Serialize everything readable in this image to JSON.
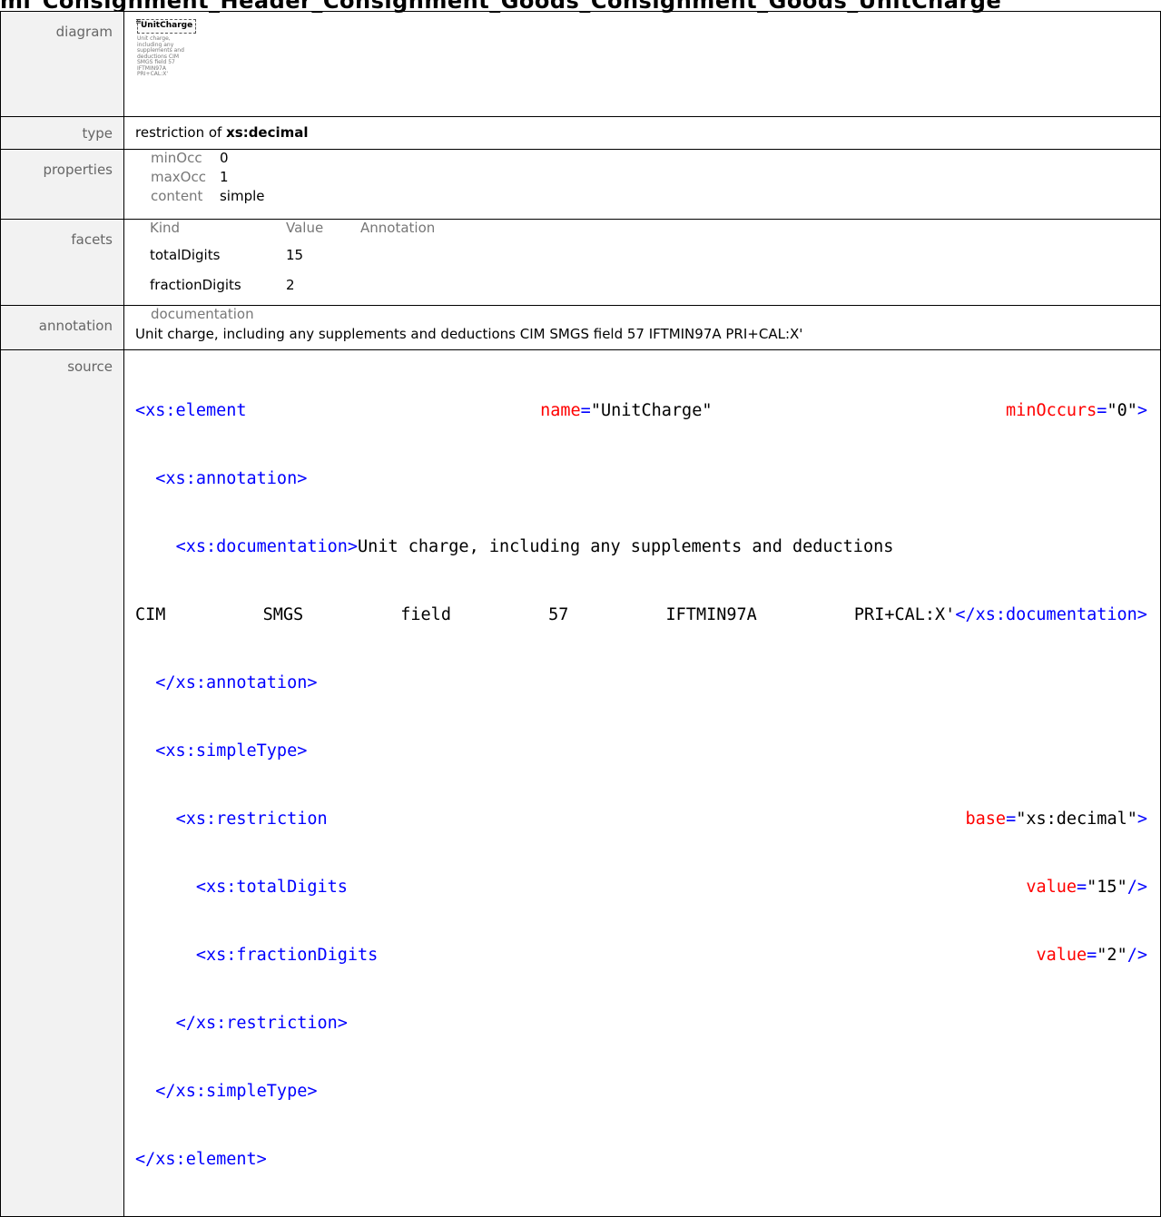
{
  "header": {
    "cut_title": "ml_Consignment_Header_Consignment_Goods_Consignment_Goods_UnitCharge"
  },
  "labels": {
    "diagram": "diagram",
    "type": "type",
    "properties": "properties",
    "facets": "facets",
    "annotation": "annotation",
    "source": "source"
  },
  "diagram": {
    "element_name": "UnitCharge",
    "documentation_lines": [
      "Unit charge,",
      "including any",
      "supplements and",
      "deductions CIM",
      "SMGS field 57",
      "IFTMIN97A",
      "PRI+CAL:X'"
    ]
  },
  "type": {
    "prefix": "restriction of",
    "base": "xs:decimal"
  },
  "properties": [
    {
      "key": "minOcc",
      "value": "0"
    },
    {
      "key": "maxOcc",
      "value": "1"
    },
    {
      "key": "content",
      "value": "simple"
    }
  ],
  "facets": {
    "headers": [
      "Kind",
      "Value",
      "Annotation"
    ],
    "rows": [
      {
        "kind": "totalDigits",
        "value": "15"
      },
      {
        "kind": "fractionDigits",
        "value": "2"
      }
    ]
  },
  "annotation": {
    "heading": "documentation",
    "text": "Unit charge, including any supplements and deductions CIM SMGS field 57 IFTMIN97A  PRI+CAL:X'"
  },
  "source": {
    "l1_open": "<xs:element",
    "l1_attr1_name": "name",
    "l1_attr1_value": "\"UnitCharge\"",
    "l1_attr2_name": "minOccurs",
    "l1_attr2_value": "\"0\"",
    "l1_close": ">",
    "l2": "<xs:annotation>",
    "l3_open": "<xs:documentation>",
    "l3_text": "Unit charge, including any supplements and deductions",
    "l4_text_parts": [
      "CIM",
      "SMGS",
      "field",
      "57",
      "IFTMIN97A",
      "PRI+CAL:X'"
    ],
    "l4_close": "</xs:documentation>",
    "l5": "</xs:annotation>",
    "l6": "<xs:simpleType>",
    "l7_open": "<xs:restriction",
    "l7_attr_name": "base",
    "l7_attr_value": "\"xs:decimal\"",
    "l7_close": ">",
    "l8_open": "<xs:totalDigits",
    "l8_attr_name": "value",
    "l8_attr_value": "\"15\"",
    "l8_close": "/>",
    "l9_open": "<xs:fractionDigits",
    "l9_attr_name": "value",
    "l9_attr_value": "\"2\"",
    "l9_close": "/>",
    "l10": "</xs:restriction>",
    "l11": "</xs:simpleType>",
    "l12": "</xs:element>"
  }
}
